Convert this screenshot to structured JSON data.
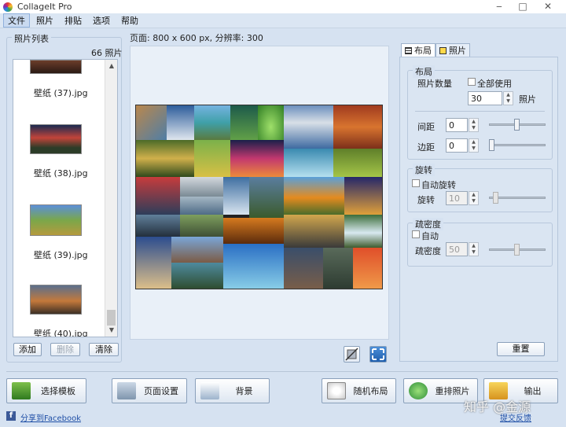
{
  "window": {
    "title": "CollageIt Pro",
    "controls": [
      "‒",
      "□",
      "✕"
    ]
  },
  "menu": [
    "文件",
    "照片",
    "排贴",
    "选项",
    "帮助"
  ],
  "photo_list": {
    "title": "照片列表",
    "count": "66 照片",
    "items": [
      {
        "name": "壁纸 (37).jpg"
      },
      {
        "name": "壁纸 (38).jpg"
      },
      {
        "name": "壁纸 (39).jpg"
      },
      {
        "name": "壁纸 (40).jpg"
      }
    ],
    "buttons": {
      "add": "添加",
      "delete": "删除",
      "clear": "清除"
    }
  },
  "page_info": "页面: 800 x 600 px, 分辨率: 300",
  "tabs": {
    "layout": "布局",
    "photo": "照片"
  },
  "layout_group": {
    "title": "布局",
    "photo_count_label": "照片数量",
    "use_all_label": "全部使用",
    "photo_count_value": "30",
    "photo_unit": "照片",
    "spacing_label": "间距",
    "spacing_value": "0",
    "margin_label": "边距",
    "margin_value": "0"
  },
  "rotation_group": {
    "title": "旋转",
    "auto_label": "自动旋转",
    "rotation_label": "旋转",
    "rotation_value": "10"
  },
  "density_group": {
    "title": "疏密度",
    "auto_label": "自动",
    "density_label": "疏密度",
    "density_value": "50"
  },
  "reset_button": "重置",
  "bottom_buttons": {
    "template": "选择模板",
    "page_setup": "页面设置",
    "background": "背景",
    "random_layout": "随机布局",
    "shuffle": "重排照片",
    "output": "输出"
  },
  "footer": {
    "share": "分享到Facebook",
    "feedback": "提交反馈",
    "watermark": "知乎 @金源"
  },
  "colors": {
    "window_bg": "#d6e2f1",
    "panel_bg": "#e9f0f8",
    "link": "#1f4fa6"
  }
}
